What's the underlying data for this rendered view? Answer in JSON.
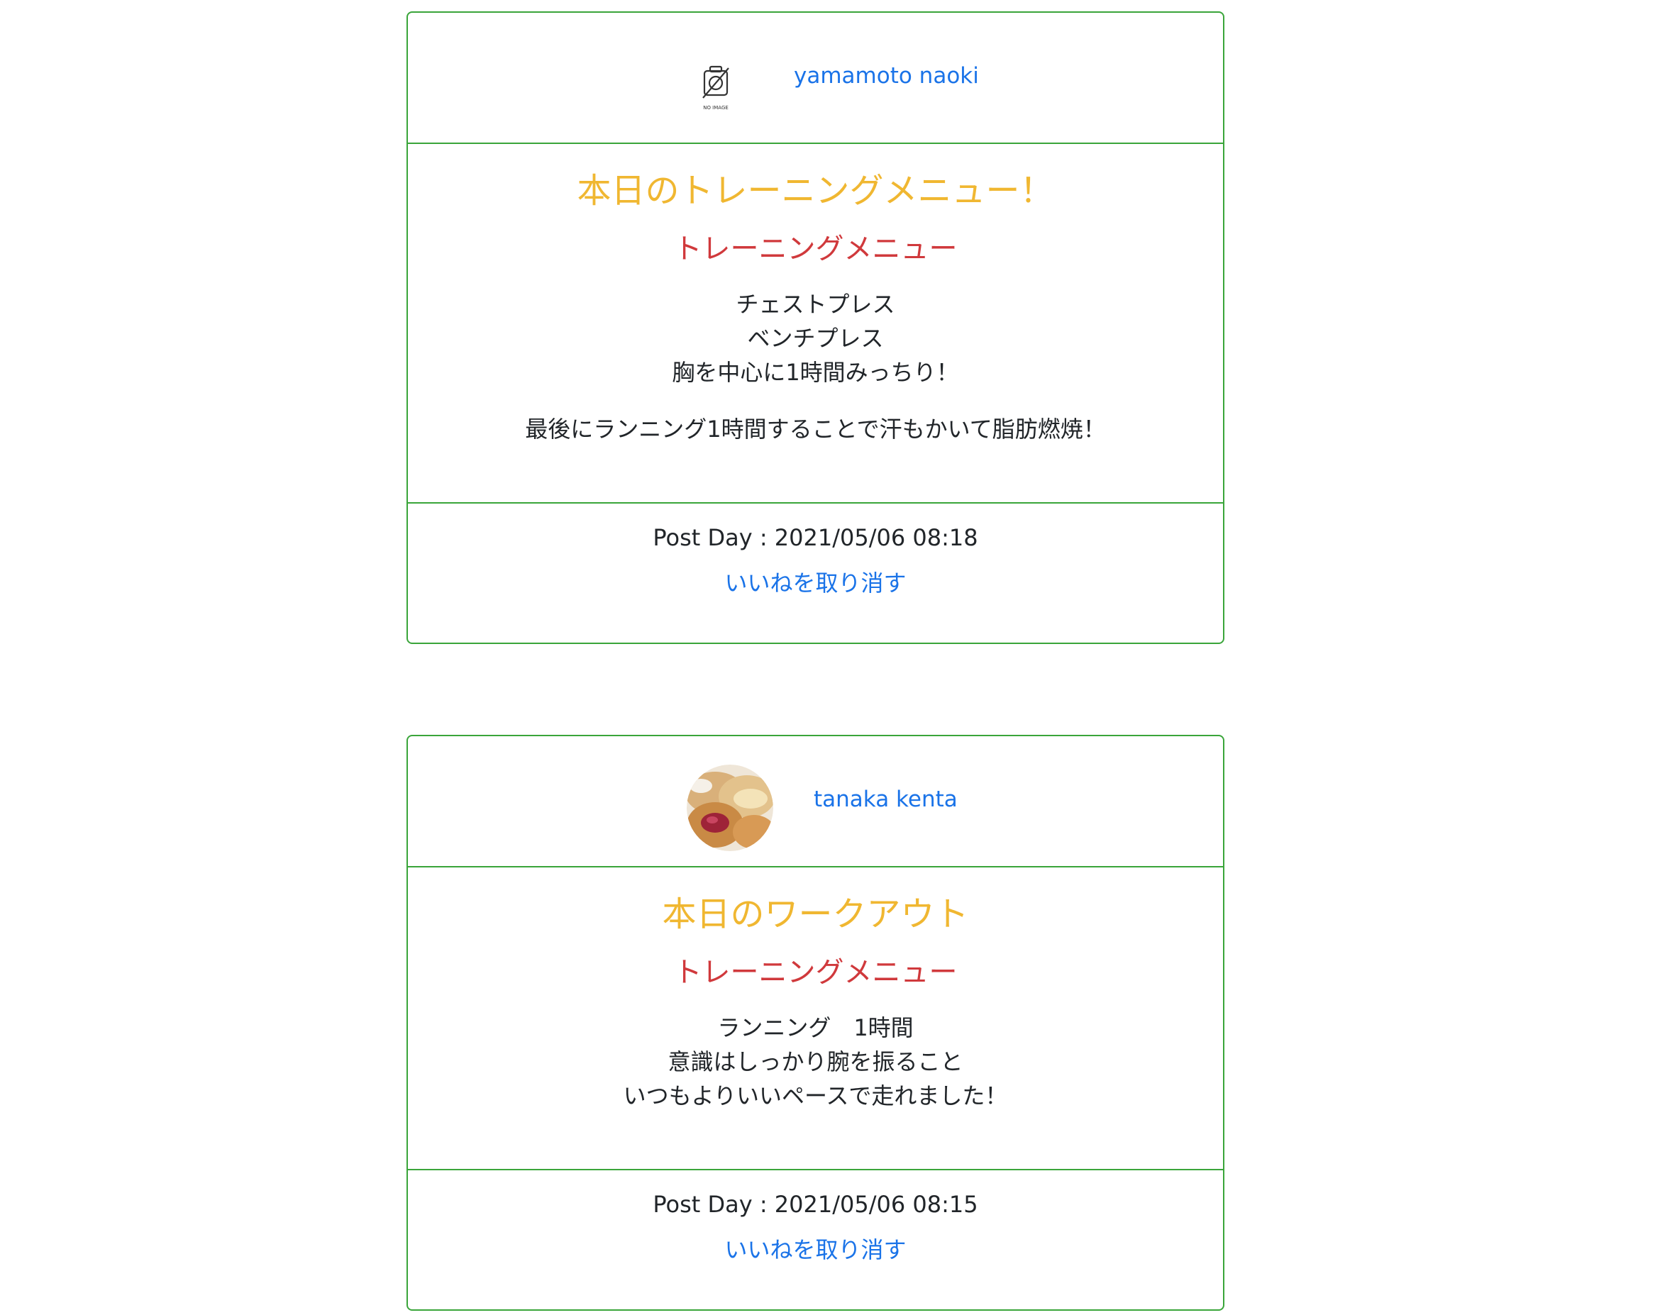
{
  "posts": [
    {
      "user": {
        "name": "yamamoto naoki",
        "avatar": "no-image-icon",
        "avatar_caption": "NO IMAGE"
      },
      "title": "本日のトレーニングメニュー！",
      "subtitle": "トレーニングメニュー",
      "lines": [
        "チェストプレス",
        "ベンチプレス",
        "胸を中心に1時間みっちり！"
      ],
      "extra_line": "最後にランニング1時間することで汗もかいて脂肪燃焼！",
      "post_day": "Post Day : 2021/05/06 08:18",
      "unlike_label": "いいねを取り消す"
    },
    {
      "user": {
        "name": "tanaka kenta",
        "avatar": "pastry-photo-avatar"
      },
      "title": "本日のワークアウト",
      "subtitle": "トレーニングメニュー",
      "lines": [
        "ランニング　1時間",
        "意識はしっかり腕を振ること",
        "いつもよりいいペースで走れました！"
      ],
      "post_day": "Post Day : 2021/05/06 08:15",
      "unlike_label": "いいねを取り消す"
    }
  ],
  "colors": {
    "card_border": "#3aa53a",
    "link": "#1a73e8",
    "title": "#f0b731",
    "subtitle": "#d0393c",
    "text": "#212529"
  }
}
